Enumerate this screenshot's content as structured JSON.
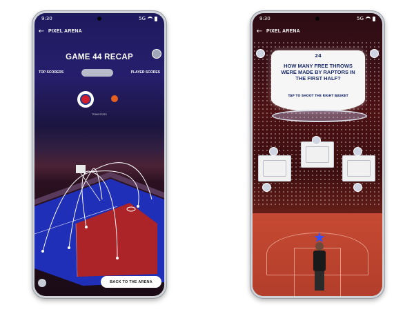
{
  "status": {
    "time": "9:30",
    "network": "5G"
  },
  "appbar": {
    "title": "PIXEL ARENA",
    "back_icon": "back-arrow-icon"
  },
  "left_screen": {
    "recap_title": "GAME 44 RECAP",
    "tabs": [
      "TOP SCORERS",
      "PLAYER SCORES"
    ],
    "team_label": "TEAM STATS",
    "back_button": "BACK TO THE ARENA",
    "colors": {
      "court_blue": "#2537c8",
      "court_red": "#b2262a"
    }
  },
  "right_screen": {
    "timer": "24",
    "question": "HOW MANY FREE THROWS WERE MADE BY RAPTORS IN THE FIRST HALF?",
    "hint": "TAP TO SHOOT THE RIGHT BASKET",
    "answers": [
      {
        "id": "answer-left"
      },
      {
        "id": "answer-middle"
      },
      {
        "id": "answer-right"
      }
    ]
  }
}
